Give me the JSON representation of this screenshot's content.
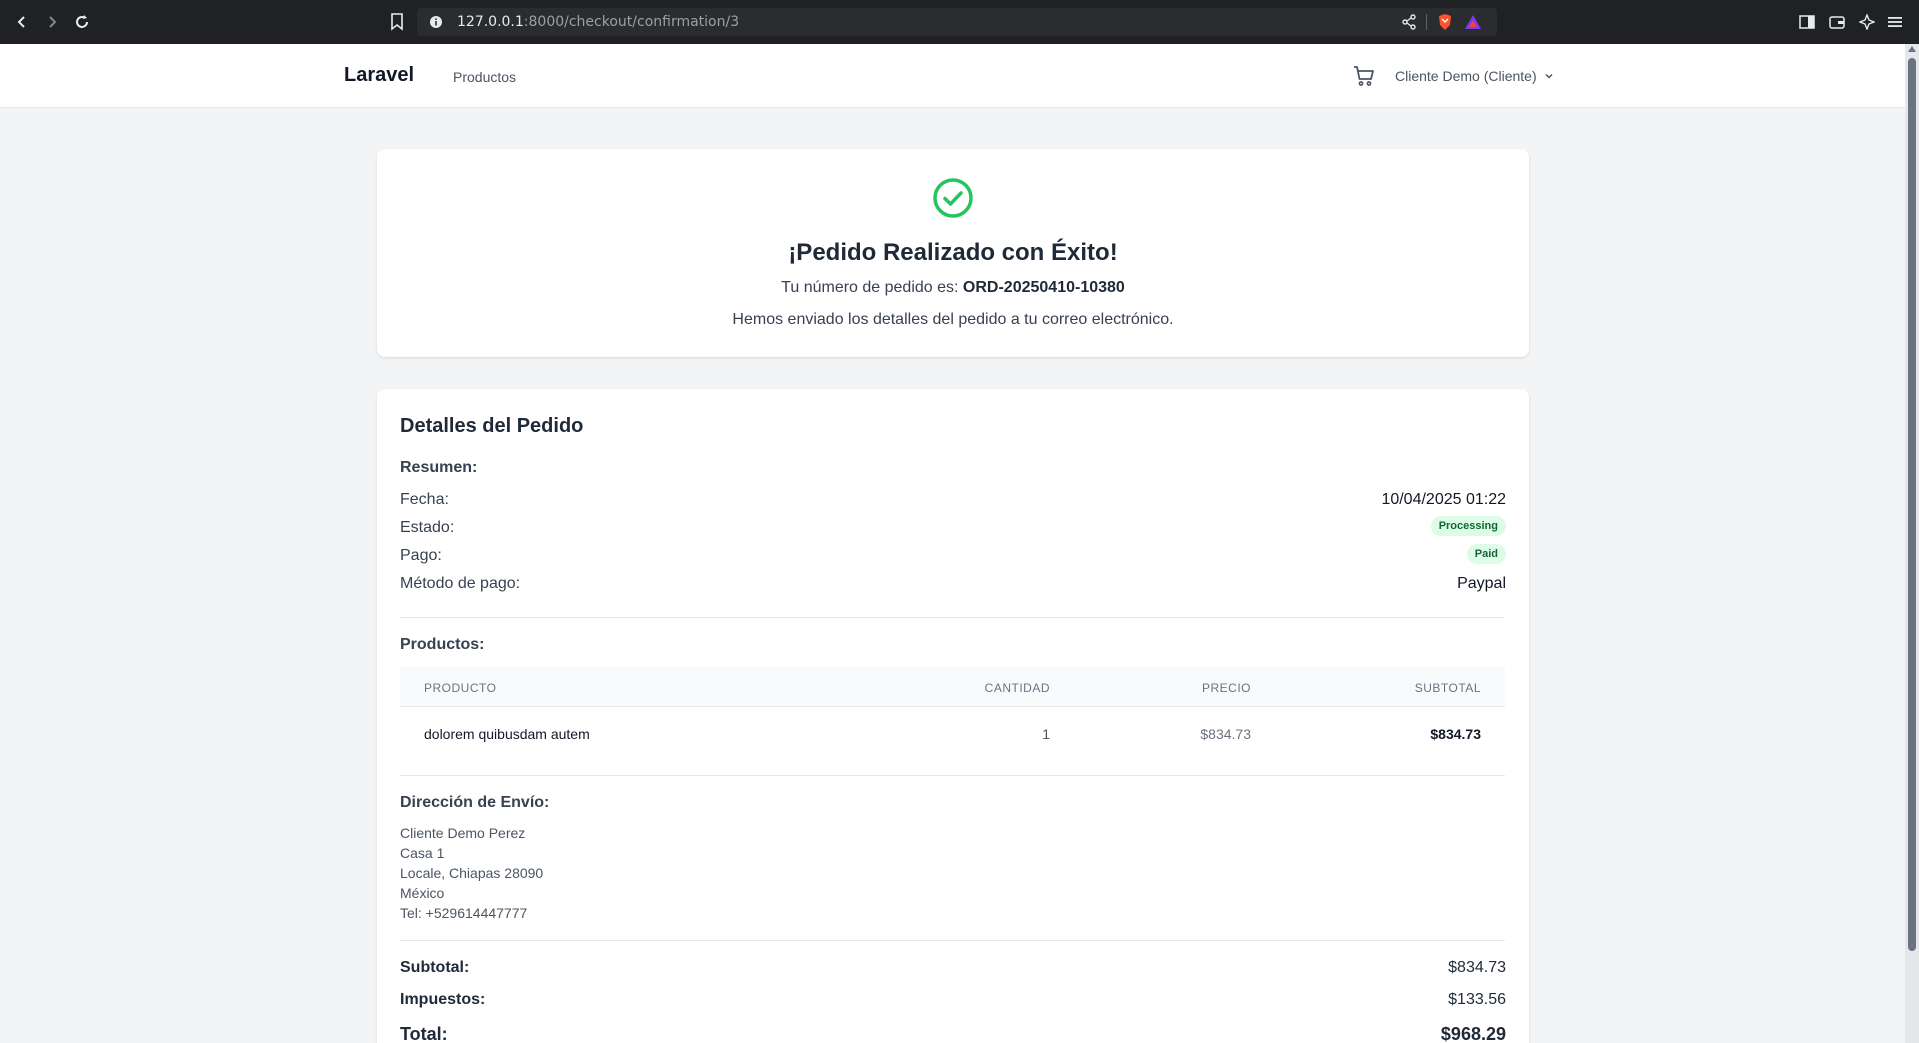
{
  "browser": {
    "url_host": "127.0.0.1",
    "url_path": ":8000/checkout/confirmation/3"
  },
  "nav": {
    "brand": "Laravel",
    "products_link": "Productos",
    "user_menu": "Cliente Demo (Cliente)"
  },
  "success": {
    "title": "¡Pedido Realizado con Éxito!",
    "order_prefix": "Tu número de pedido es:",
    "order_number": "ORD-20250410-10380",
    "email_note": "Hemos enviado los detalles del pedido a tu correo electrónico."
  },
  "details": {
    "title": "Detalles del Pedido",
    "summary_label": "Resumen:",
    "date_label": "Fecha:",
    "date_value": "10/04/2025 01:22",
    "status_label": "Estado:",
    "status_value": "Processing",
    "payment_label": "Pago:",
    "payment_value": "Paid",
    "method_label": "Método de pago:",
    "method_value": "Paypal",
    "products_label": "Productos:",
    "table": {
      "headers": [
        "PRODUCTO",
        "CANTIDAD",
        "PRECIO",
        "SUBTOTAL"
      ],
      "rows": [
        {
          "product": "dolorem quibusdam autem",
          "qty": "1",
          "price": "$834.73",
          "subtotal": "$834.73"
        }
      ]
    },
    "shipping_label": "Dirección de Envío:",
    "address": [
      "Cliente Demo Perez",
      "Casa 1",
      "Locale, Chiapas 28090",
      "México",
      "Tel: +529614447777"
    ],
    "subtotal_label": "Subtotal:",
    "subtotal_value": "$834.73",
    "tax_label": "Impuestos:",
    "tax_value": "$133.56",
    "total_label": "Total:",
    "total_value": "$968.29"
  },
  "colors": {
    "success_green": "#22c55e",
    "badge_bg": "#dcfce7",
    "badge_text": "#166534"
  }
}
